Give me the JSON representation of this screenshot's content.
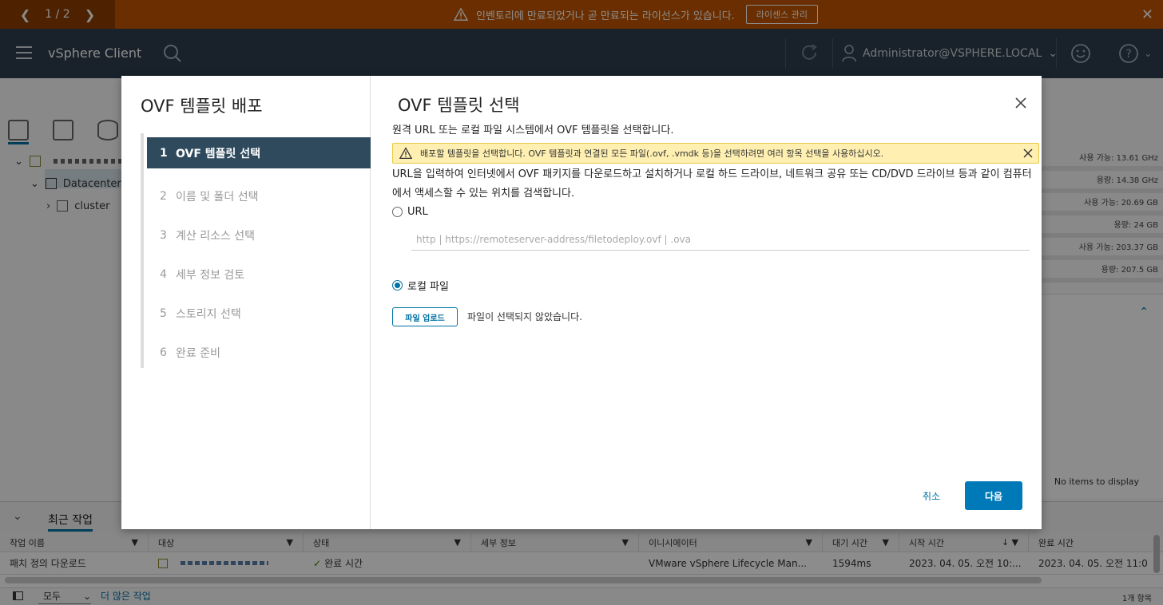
{
  "banner": {
    "pager": "1 / 2",
    "message": "인벤토리에 만료되었거나 곧 만료되는 라이선스가 있습니다.",
    "manage_button": "라이센스 관리",
    "color": "#c25400"
  },
  "header": {
    "app_title": "vSphere Client",
    "user": "Administrator@VSPHERE.LOCAL",
    "color": "#2e3f4f"
  },
  "tree": {
    "items": [
      {
        "label": "",
        "icon": "vcenter-icon"
      },
      {
        "label": "Datacenter",
        "icon": "datacenter-icon"
      },
      {
        "label": "cluster",
        "icon": "cluster-icon"
      }
    ]
  },
  "right_stats": [
    "사용 가능: 13.61 GHz",
    "용량: 14.38 GHz",
    "사용 가능: 20.69 GB",
    "용량: 24 GB",
    "사용 가능: 203.37 GB",
    "용량: 207.5 GB"
  ],
  "right_panel_empty": "No items to display",
  "tasks": {
    "tab_label": "최근 작업",
    "columns": [
      "작업 이름",
      "대상",
      "상태",
      "세부 정보",
      "이니시에이터",
      "대기 시간",
      "시작 시간",
      "완료 시간"
    ],
    "rows": [
      {
        "name": "패치 정의 다운로드",
        "target": "",
        "status": "완료 시간",
        "details": "",
        "initiator": "VMware vSphere Lifecycle Man...",
        "queued": "1594ms",
        "start": "2023. 04. 05. 오전 10:...",
        "end": "2023. 04. 05. 오전 11:0"
      }
    ],
    "filter": "모두",
    "more_tasks": "더 많은 작업",
    "count": "1개 항목"
  },
  "wizard": {
    "title": "OVF 템플릿 배포",
    "steps": [
      {
        "num": "1",
        "label": "OVF 템플릿 선택",
        "active": true
      },
      {
        "num": "2",
        "label": "이름 및 폴더 선택",
        "active": false
      },
      {
        "num": "3",
        "label": "계산 리소스 선택",
        "active": false
      },
      {
        "num": "4",
        "label": "세부 정보 검토",
        "active": false
      },
      {
        "num": "5",
        "label": "스토리지 선택",
        "active": false
      },
      {
        "num": "6",
        "label": "완료 준비",
        "active": false
      }
    ],
    "page_title": "OVF 템플릿 선택",
    "subtitle": "원격 URL 또는 로컬 파일 시스템에서 OVF 템플릿을 선택합니다.",
    "alert": "배포할 템플릿을 선택합니다. OVF 템플릿과 연결된 모든 파일(.ovf, .vmdk 등)을 선택하려면 여러 항목 선택을 사용하십시오.",
    "description": "URL을 입력하여 인터넷에서 OVF 패키지를 다운로드하고 설치하거나 로컬 하드 드라이브, 네트워크 공유 또는 CD/DVD 드라이브 등과 같이 컴퓨터에서 액세스할 수 있는 위치를 검색합니다.",
    "url_option": "URL",
    "url_placeholder": "http | https://remoteserver-address/filetodeploy.ovf | .ova",
    "url_value": "",
    "local_option": "로컬 파일",
    "selected_option": "local",
    "upload_button": "파일 업로드",
    "no_file": "파일이 선택되지 않았습니다.",
    "cancel": "취소",
    "next": "다음",
    "accent": "#0079b8"
  }
}
